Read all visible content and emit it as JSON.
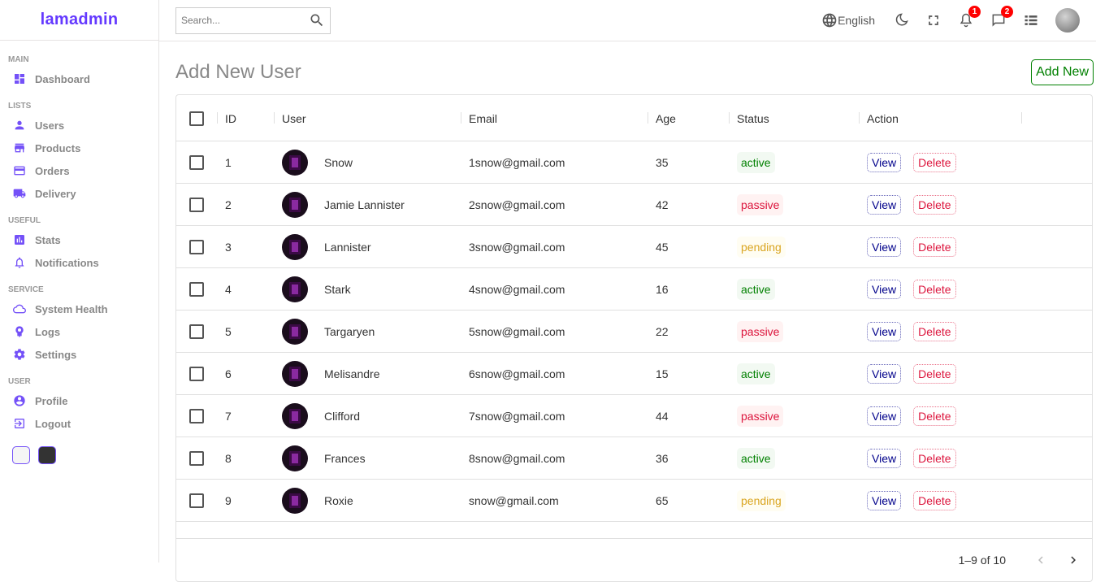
{
  "app": {
    "name": "lamadmin"
  },
  "sidebar": {
    "sections": [
      {
        "title": "MAIN",
        "items": [
          {
            "label": "Dashboard",
            "icon": "dashboard-icon"
          }
        ]
      },
      {
        "title": "LISTS",
        "items": [
          {
            "label": "Users",
            "icon": "person-icon"
          },
          {
            "label": "Products",
            "icon": "store-icon"
          },
          {
            "label": "Orders",
            "icon": "credit-card-icon"
          },
          {
            "label": "Delivery",
            "icon": "truck-icon"
          }
        ]
      },
      {
        "title": "USEFUL",
        "items": [
          {
            "label": "Stats",
            "icon": "bar-chart-icon"
          },
          {
            "label": "Notifications",
            "icon": "bell-icon"
          }
        ]
      },
      {
        "title": "SERVICE",
        "items": [
          {
            "label": "System Health",
            "icon": "cloud-icon"
          },
          {
            "label": "Logs",
            "icon": "psychology-icon"
          },
          {
            "label": "Settings",
            "icon": "settings-icon"
          }
        ]
      },
      {
        "title": "USER",
        "items": [
          {
            "label": "Profile",
            "icon": "account-circle-icon"
          },
          {
            "label": "Logout",
            "icon": "logout-icon"
          }
        ]
      }
    ]
  },
  "navbar": {
    "search_placeholder": "Search...",
    "language": "English",
    "notifications_count": "1",
    "messages_count": "2"
  },
  "page": {
    "title": "Add New User",
    "add_button": "Add New"
  },
  "table": {
    "columns": [
      "ID",
      "User",
      "Email",
      "Age",
      "Status",
      "Action"
    ],
    "view_label": "View",
    "delete_label": "Delete",
    "rows": [
      {
        "id": "1",
        "user": "Snow",
        "email": "1snow@gmail.com",
        "age": "35",
        "status": "active"
      },
      {
        "id": "2",
        "user": "Jamie Lannister",
        "email": "2snow@gmail.com",
        "age": "42",
        "status": "passive"
      },
      {
        "id": "3",
        "user": "Lannister",
        "email": "3snow@gmail.com",
        "age": "45",
        "status": "pending"
      },
      {
        "id": "4",
        "user": "Stark",
        "email": "4snow@gmail.com",
        "age": "16",
        "status": "active"
      },
      {
        "id": "5",
        "user": "Targaryen",
        "email": "5snow@gmail.com",
        "age": "22",
        "status": "passive"
      },
      {
        "id": "6",
        "user": "Melisandre",
        "email": "6snow@gmail.com",
        "age": "15",
        "status": "active"
      },
      {
        "id": "7",
        "user": "Clifford",
        "email": "7snow@gmail.com",
        "age": "44",
        "status": "passive"
      },
      {
        "id": "8",
        "user": "Frances",
        "email": "8snow@gmail.com",
        "age": "36",
        "status": "active"
      },
      {
        "id": "9",
        "user": "Roxie",
        "email": "snow@gmail.com",
        "age": "65",
        "status": "pending"
      }
    ],
    "pagination": "1–9 of 10"
  },
  "colors": {
    "accent": "#7451f8",
    "logo": "#6439ff"
  }
}
